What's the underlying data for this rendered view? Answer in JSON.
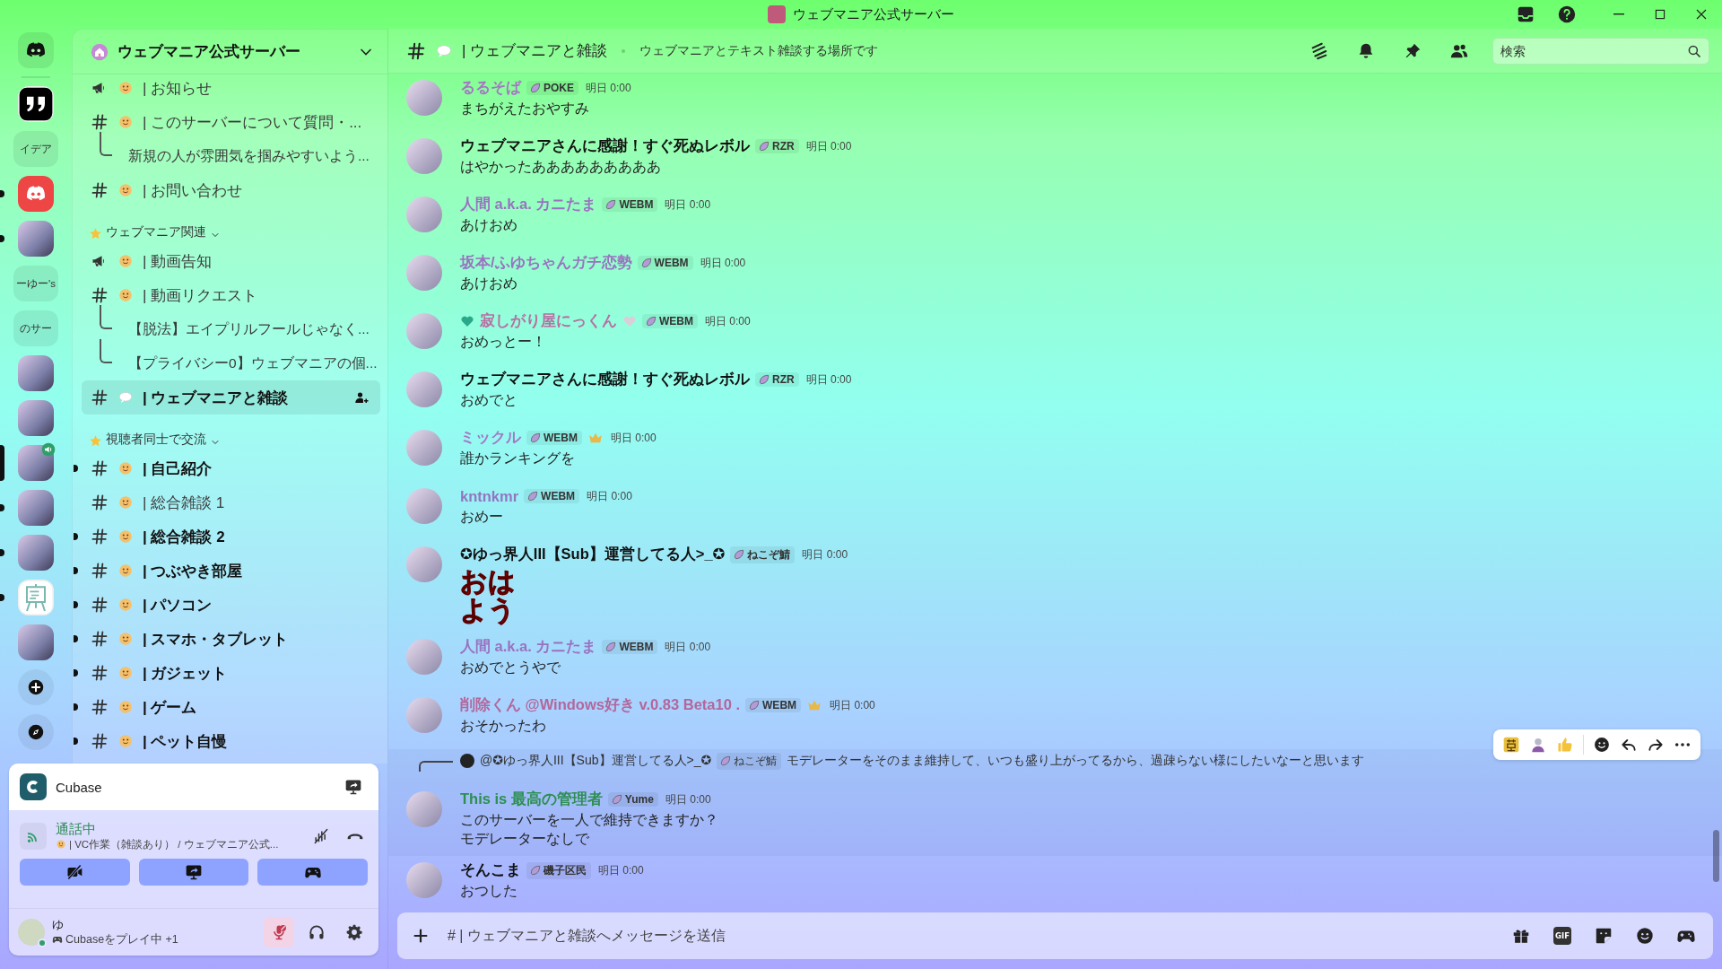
{
  "title_bar": {
    "title": "ウェブマニア公式サーバー"
  },
  "servers": [
    {
      "kind": "home",
      "unread": false,
      "selected": false
    },
    {
      "kind": "quote",
      "unread": false,
      "selected": false
    },
    {
      "kind": "text",
      "label": "イデア",
      "unread": false,
      "selected": false
    },
    {
      "kind": "logo",
      "unread": true,
      "selected": false
    },
    {
      "kind": "image",
      "unread": true,
      "selected": false
    },
    {
      "kind": "text",
      "label": "ーゆー's",
      "unread": false,
      "selected": false
    },
    {
      "kind": "text",
      "label": "のサー",
      "unread": false,
      "selected": false
    },
    {
      "kind": "image",
      "unread": false,
      "selected": false
    },
    {
      "kind": "image",
      "unread": false,
      "selected": false
    },
    {
      "kind": "image",
      "unread": false,
      "selected": true,
      "in_voice": true
    },
    {
      "kind": "image",
      "unread": true,
      "selected": false
    },
    {
      "kind": "image",
      "unread": true,
      "selected": false
    },
    {
      "kind": "easel",
      "unread": true,
      "selected": false
    },
    {
      "kind": "image",
      "unread": false,
      "selected": false
    },
    {
      "kind": "add",
      "unread": false,
      "selected": false
    },
    {
      "kind": "discover",
      "unread": false,
      "selected": false
    }
  ],
  "sidebar": {
    "server_name": "ウェブマニア公式サーバー",
    "sections": [
      {
        "channels": [
          {
            "kind": "announcement",
            "name": "| お知らせ",
            "selected": false,
            "unread": false
          },
          {
            "kind": "text",
            "name": "| このサーバーについて質問・...",
            "selected": false,
            "unread": false,
            "children": [
              {
                "kind": "thread",
                "name": "新規の人が雰囲気を掴みやすいよう...",
                "selected": false,
                "unread": false
              }
            ]
          },
          {
            "kind": "text",
            "name": "| お問い合わせ",
            "selected": false,
            "unread": false
          }
        ]
      },
      {
        "title": "ウェブマニア関連",
        "expanded": true,
        "channels": [
          {
            "kind": "announcement",
            "name": "| 動画告知",
            "selected": false,
            "unread": false
          },
          {
            "kind": "text",
            "name": "| 動画リクエスト",
            "selected": false,
            "unread": false,
            "children": [
              {
                "kind": "thread",
                "name": "【脱法】エイプリルフールじゃなく...",
                "selected": false,
                "unread": false
              },
              {
                "kind": "thread",
                "name": "【プライバシー0】ウェブマニアの個...",
                "selected": false,
                "unread": false
              }
            ]
          },
          {
            "kind": "text",
            "name": "| ウェブマニアと雑談",
            "selected": true,
            "unread": false
          }
        ]
      },
      {
        "title": "視聴者同士で交流",
        "expanded": true,
        "channels": [
          {
            "kind": "text",
            "name": "| 自己紹介",
            "selected": false,
            "unread": true
          },
          {
            "kind": "text",
            "name": "| 総合雑談 1",
            "selected": false,
            "unread": false
          },
          {
            "kind": "text",
            "name": "| 総合雑談 2",
            "selected": false,
            "unread": true
          },
          {
            "kind": "text",
            "name": "| つぶやき部屋",
            "selected": false,
            "unread": true
          },
          {
            "kind": "text",
            "name": "| パソコン",
            "selected": false,
            "unread": true
          },
          {
            "kind": "text",
            "name": "| スマホ・タブレット",
            "selected": false,
            "unread": true
          },
          {
            "kind": "text",
            "name": "| ガジェット",
            "selected": false,
            "unread": true
          },
          {
            "kind": "text",
            "name": "| ゲーム",
            "selected": false,
            "unread": true
          },
          {
            "kind": "text",
            "name": "| ペット自慢",
            "selected": false,
            "unread": true
          }
        ]
      }
    ]
  },
  "voice_panel": {
    "activity": {
      "name": "Cubase"
    },
    "connection": {
      "status": "通話中",
      "channel": "| VC作業（雑談あり） / ウェブマニア公式..."
    },
    "camera_on": false,
    "user": {
      "name": "ゆ",
      "status": "Cubaseをプレイ中 +1",
      "mic_muted": true
    }
  },
  "chat": {
    "header": {
      "name": "| ウェブマニアと雑談",
      "topic": "ウェブマニアとテキスト雑談する場所です",
      "search_placeholder": "検索"
    },
    "messages": [
      {
        "author": "るるそば",
        "color": "#a677c4",
        "tag": "POKE",
        "time": "明日 0:00",
        "kind": "text",
        "lines": [
          "まちがえたおやすみ"
        ],
        "heart_icons": false,
        "role_icon": false,
        "highlighted": false
      },
      {
        "author": "ウェブマニアさんに感謝！すぐ死ぬレボル",
        "color": "#111111",
        "tag": "RZR",
        "time": "明日 0:00",
        "kind": "text",
        "lines": [
          "はやかったあああああああああ"
        ],
        "heart_icons": false,
        "role_icon": false,
        "highlighted": false
      },
      {
        "author": "人間 a.k.a. カニたま",
        "color": "#9a72c0",
        "tag": "WEBM",
        "time": "明日 0:00",
        "kind": "text",
        "lines": [
          "あけおめ"
        ],
        "heart_icons": false,
        "role_icon": false,
        "highlighted": false
      },
      {
        "author": "坂本/ふゆちゃんガチ恋勢",
        "color": "#9a72c0",
        "tag": "WEBM",
        "time": "明日 0:00",
        "kind": "text",
        "lines": [
          "あけおめ"
        ],
        "heart_icons": false,
        "role_icon": false,
        "highlighted": false
      },
      {
        "author": "寂しがり屋にっくん",
        "color": "#b86fa4",
        "tag": "WEBM",
        "time": "明日 0:00",
        "kind": "text",
        "lines": [
          "おめっとー！"
        ],
        "heart_icons": true,
        "role_icon": false,
        "highlighted": false
      },
      {
        "author": "ウェブマニアさんに感謝！すぐ死ぬレボル",
        "color": "#111111",
        "tag": "RZR",
        "time": "明日 0:00",
        "kind": "text",
        "lines": [
          "おめでと"
        ],
        "heart_icons": false,
        "role_icon": false,
        "highlighted": false
      },
      {
        "author": "ミックル",
        "color": "#a677c4",
        "tag": "WEBM",
        "time": "明日 0:00",
        "kind": "text",
        "lines": [
          "誰かランキングを"
        ],
        "heart_icons": false,
        "role_icon": true,
        "highlighted": false
      },
      {
        "author": "kntnkmr",
        "color": "#9475c0",
        "tag": "WEBM",
        "time": "明日 0:00",
        "kind": "text",
        "lines": [
          "おめー"
        ],
        "heart_icons": false,
        "role_icon": false,
        "highlighted": false
      },
      {
        "author": "✪ゆっ界人III【Sub】運営してる人>_✪",
        "color": "#111111",
        "tag": "ねこぞ鯖",
        "time": "明日 0:00",
        "kind": "sticker",
        "text": "おはよう",
        "heart_icons": false,
        "role_icon": false,
        "highlighted": false
      },
      {
        "author": "人間 a.k.a. カニたま",
        "color": "#9a72c0",
        "tag": "WEBM",
        "time": "明日 0:00",
        "kind": "text",
        "lines": [
          "おめでとうやで"
        ],
        "heart_icons": false,
        "role_icon": false,
        "highlighted": false
      },
      {
        "author": "削除くん @Windows好き v.0.83 Beta10 .",
        "color": "#b3679a",
        "tag": "WEBM",
        "time": "明日 0:00",
        "kind": "text",
        "lines": [
          "おそかったわ"
        ],
        "heart_icons": false,
        "role_icon": true,
        "highlighted": false
      },
      {
        "author": "This is 最高の管理者",
        "color": "#2e8e52",
        "tag": "Yume",
        "time": "明日 0:00",
        "kind": "text",
        "lines": [
          "このサーバーを一人で維持できますか？",
          "モデレーターなしで"
        ],
        "heart_icons": false,
        "role_icon": false,
        "highlighted": true,
        "reply": {
          "author": "@✪ゆっ界人III【Sub】運営してる人>_✪",
          "tag": "ねこぞ鯖",
          "text": "モデレーターをそのまま維持して、いつも盛り上がってるから、過疎らない様にしたいなーと思います"
        }
      },
      {
        "author": "そんこま",
        "color": "#111111",
        "tag": "磯子区民",
        "time": "明日 0:00",
        "kind": "text",
        "lines": [
          "おつした"
        ],
        "heart_icons": false,
        "role_icon": false,
        "highlighted": false
      }
    ],
    "composer": {
      "placeholder": "# | ウェブマニアと雑談へメッセージを送信",
      "gif_label": "GIF"
    }
  }
}
